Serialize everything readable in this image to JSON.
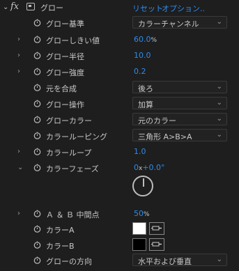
{
  "header": {
    "fx_label": "fx",
    "effect_name": "グロー",
    "reset_label": "リセット",
    "options_label": "オプション..",
    "collapse_icon": "chevron-down-icon"
  },
  "properties": [
    {
      "label": "グロー基準",
      "type": "dropdown",
      "value": "カラーチャンネル",
      "expandable": false
    },
    {
      "label": "グローしきい値",
      "type": "number",
      "value": "60.0",
      "unit": "%",
      "expandable": true
    },
    {
      "label": "グロー半径",
      "type": "number",
      "value": "10.0",
      "expandable": true
    },
    {
      "label": "グロー強度",
      "type": "number",
      "value": "0.2",
      "expandable": true
    },
    {
      "label": "元を合成",
      "type": "dropdown",
      "value": "後ろ",
      "expandable": false
    },
    {
      "label": "グロー操作",
      "type": "dropdown",
      "value": "加算",
      "expandable": false
    },
    {
      "label": "グローカラー",
      "type": "dropdown",
      "value": "元のカラー",
      "expandable": false
    },
    {
      "label": "カラールーピング",
      "type": "dropdown",
      "value": "三角形 A>B>A",
      "expandable": false
    },
    {
      "label": "カラーループ",
      "type": "number",
      "value": "1.0",
      "expandable": true
    },
    {
      "label": "カラーフェーズ",
      "type": "angle",
      "value": "0",
      "value_x": "x",
      "value_deg": "+0.0",
      "unit": "°",
      "expandable": true,
      "angle_degrees": 0
    },
    {
      "label": "Ａ ＆ Ｂ 中間点",
      "type": "number",
      "value": "50",
      "unit": "%",
      "expandable": true
    },
    {
      "label": "カラーA",
      "type": "color",
      "color": "#ffffff",
      "expandable": false
    },
    {
      "label": "カラーB",
      "type": "color",
      "color": "#000000",
      "expandable": false
    },
    {
      "label": "グローの方向",
      "type": "dropdown",
      "value": "水平および垂直",
      "expandable": false
    }
  ],
  "colors": {
    "background": "#1e1e1e",
    "accent_value": "#2d8ceb",
    "text": "#c8c8c8"
  }
}
